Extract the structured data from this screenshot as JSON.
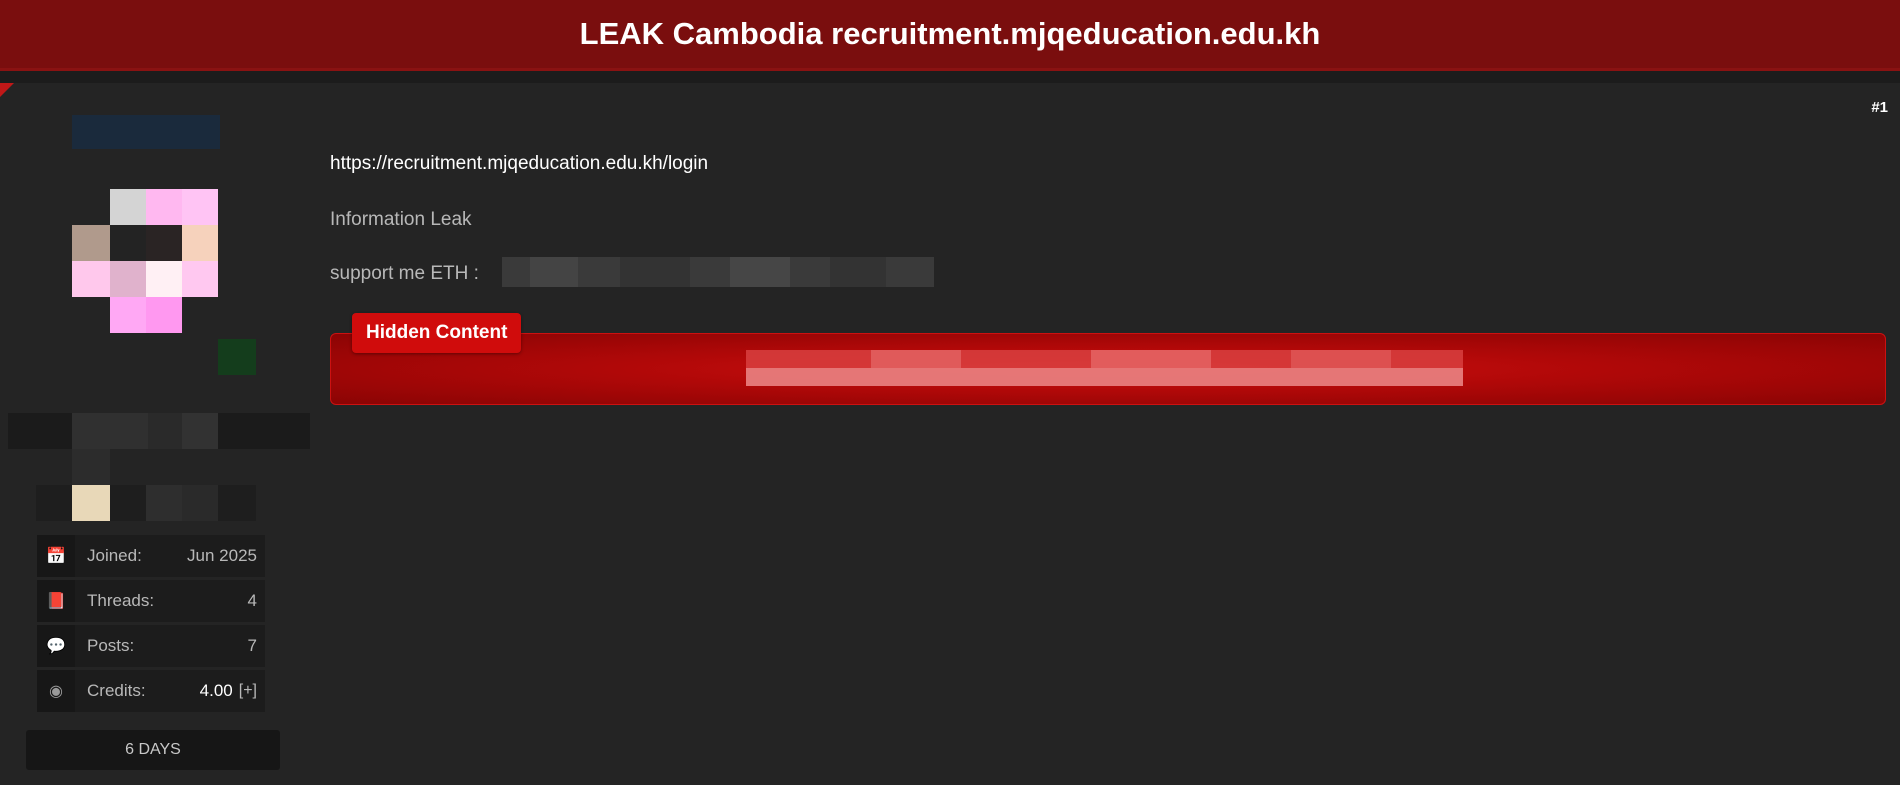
{
  "thread": {
    "title": "LEAK Cambodia recruitment.mjqeducation.edu.kh",
    "post_number": "#1"
  },
  "post": {
    "link": "https://recruitment.mjqeducation.edu.kh/login",
    "info": "Information Leak",
    "support_label": "support me  ETH :",
    "hidden_label": "Hidden Content"
  },
  "user": {
    "stats": [
      {
        "icon": "calendar-icon",
        "label": "Joined:",
        "value": "Jun 2025"
      },
      {
        "icon": "book-icon",
        "label": "Threads:",
        "value": "4"
      },
      {
        "icon": "comments-icon",
        "label": "Posts:",
        "value": "7"
      },
      {
        "icon": "coins-icon",
        "label": "Credits:",
        "value": "4.00",
        "action": "[+]"
      }
    ],
    "status": "6 DAYS"
  },
  "colors": {
    "header_bg": "#7a0e0e",
    "accent_red": "#d00c0c",
    "page_bg": "#232323"
  }
}
